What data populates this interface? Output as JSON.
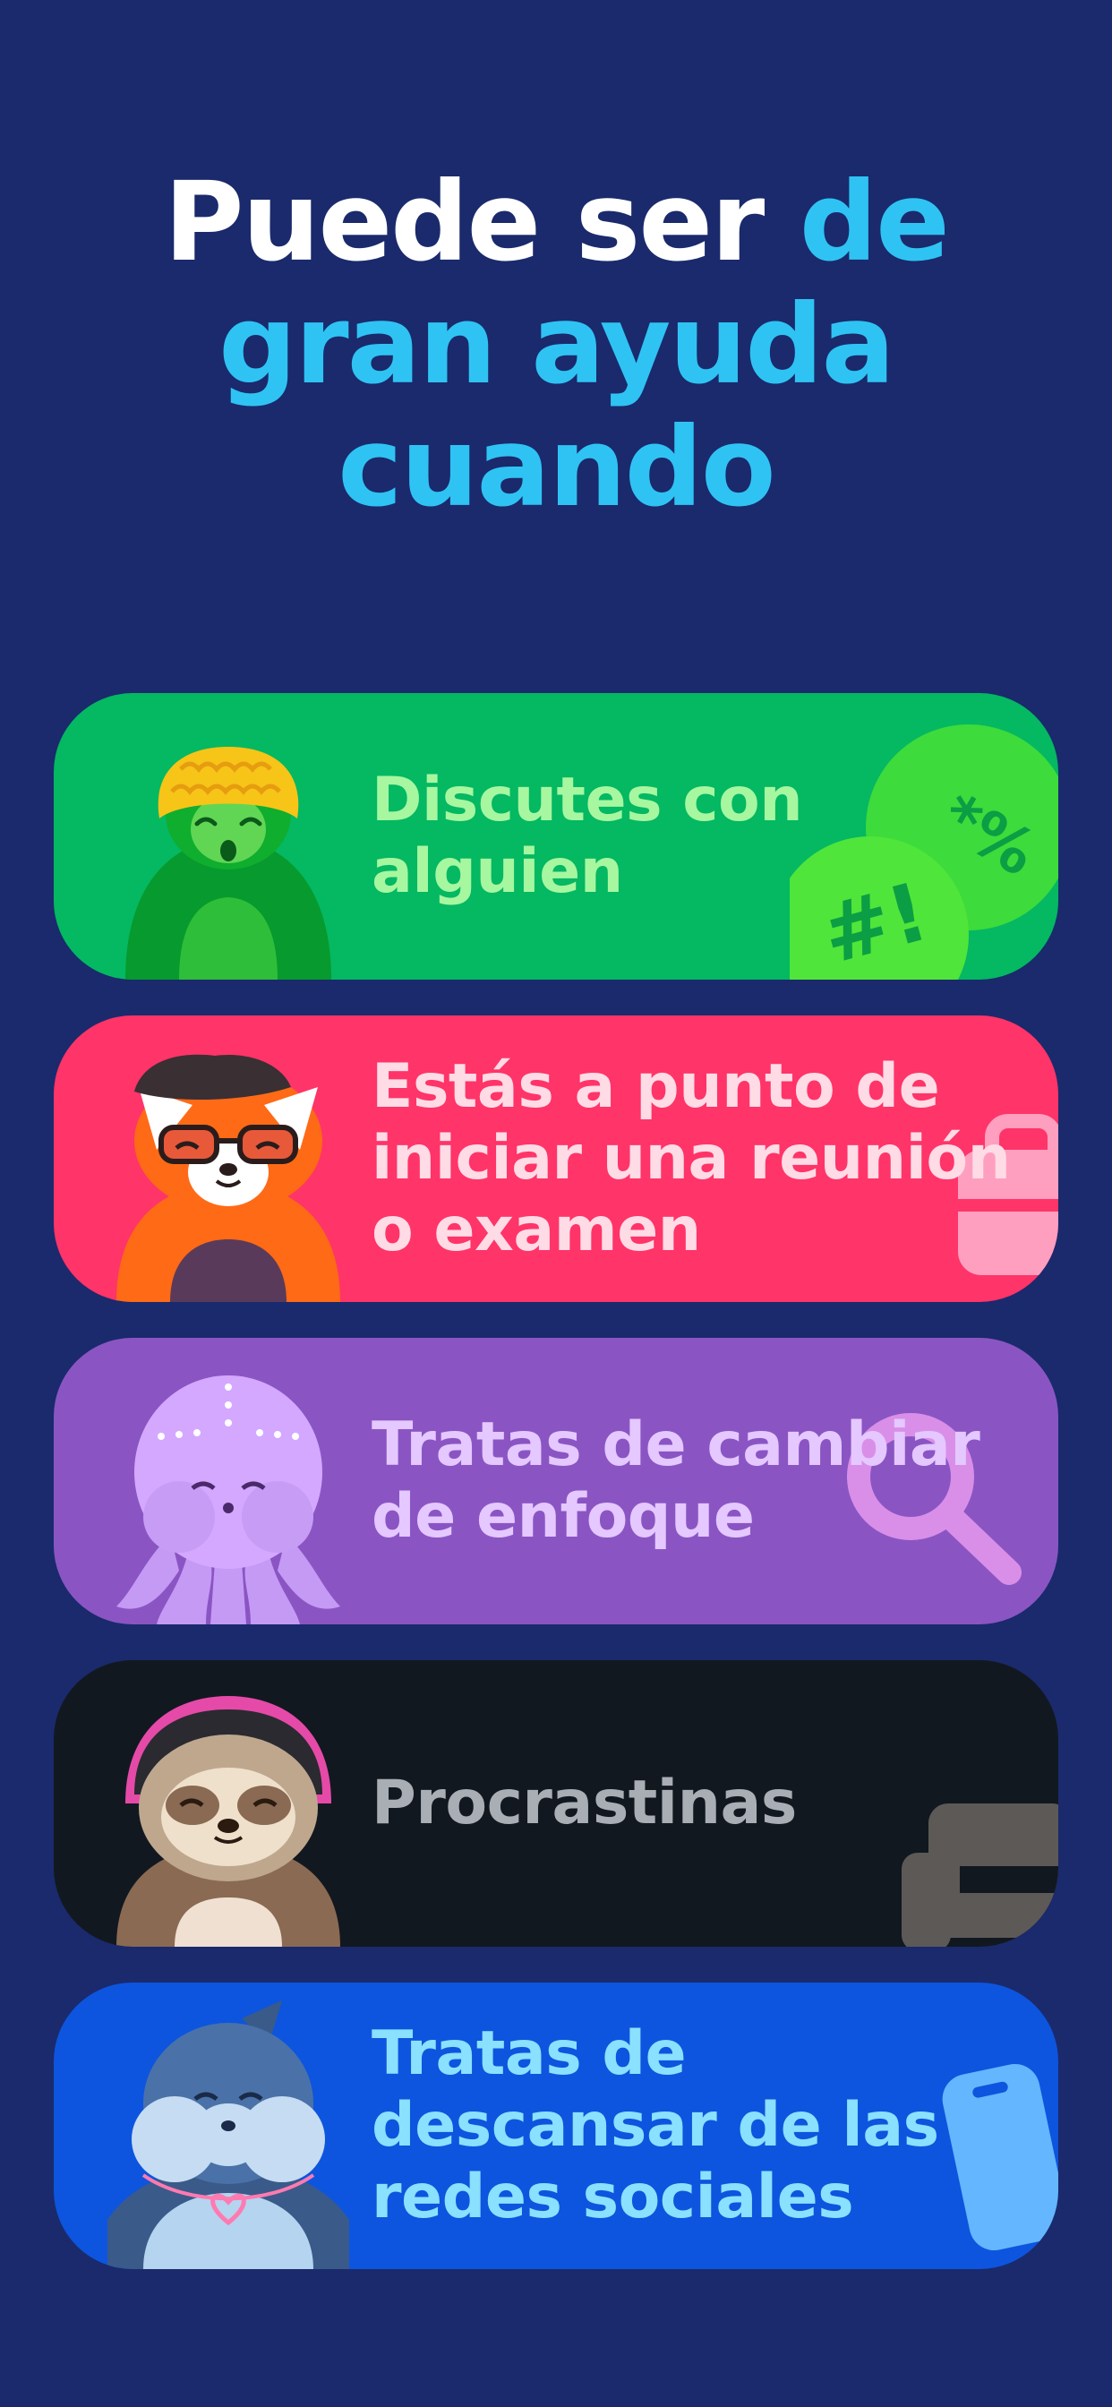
{
  "headline": {
    "line1_white": "Puede ser ",
    "line1_blue": "de",
    "line2": "gran ayuda",
    "line3": "cuando"
  },
  "cards": [
    {
      "text_line1": "Discutes con",
      "text_line2": "alguien",
      "text_line3": "",
      "bg": "#05b862",
      "text_color": "#a6f7a0",
      "mascot": "turtle-with-beanie",
      "deco": "speech-bubbles-icon"
    },
    {
      "text_line1": "Estás a punto de",
      "text_line2": "iniciar una reunión",
      "text_line3": "o examen",
      "bg": "#ff3468",
      "text_color": "#ffdbe6",
      "mascot": "red-panda-with-beret",
      "deco": "briefcase-icon"
    },
    {
      "text_line1": "Tratas de cambiar",
      "text_line2": "de enfoque",
      "text_line3": "",
      "bg": "#8a55c3",
      "text_color": "#e4c8ff",
      "mascot": "octopus",
      "deco": "magnifier-icon"
    },
    {
      "text_line1": "Procrastinas",
      "text_line2": "",
      "text_line3": "",
      "bg": "#121820",
      "text_color": "#a9adb4",
      "mascot": "sloth-with-hood",
      "deco": "armchair-icon"
    },
    {
      "text_line1": "Tratas de",
      "text_line2": "descansar de las",
      "text_line3": "redes sociales",
      "bg": "#0d55de",
      "text_color": "#8ae0ff",
      "mascot": "dolphin-with-necklace",
      "deco": "phone-icon"
    }
  ]
}
